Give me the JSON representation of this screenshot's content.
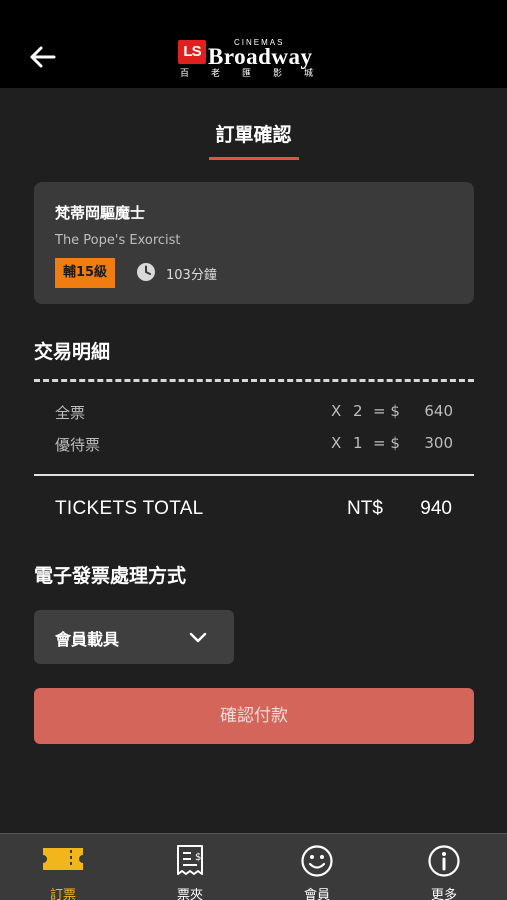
{
  "header": {
    "back_icon": "arrow-left-icon",
    "logo": {
      "badge": "LS",
      "cinemas": "CINEMAS",
      "brand": "Broadway",
      "sub": "百老匯影城"
    }
  },
  "page": {
    "title": "訂單確認"
  },
  "movie": {
    "name": "梵蒂岡驅魔士",
    "english_name": "The Pope's Exorcist",
    "rating": "輔15級",
    "duration": "103分鐘",
    "rating_color": "#ef7d10"
  },
  "transaction": {
    "title": "交易明細",
    "items": [
      {
        "name": "全票",
        "x": "X",
        "qty": "2",
        "eq": "= $",
        "amount": "640"
      },
      {
        "name": "優待票",
        "x": "X",
        "qty": "1",
        "eq": "= $",
        "amount": "300"
      }
    ],
    "total_label": "TICKETS TOTAL",
    "total_currency": "NT$",
    "total_amount": "940"
  },
  "invoice": {
    "title": "電子發票處理方式",
    "selected": "會員載具"
  },
  "confirm_button": {
    "label": "確認付款",
    "color": "#d4655b"
  },
  "tabbar": {
    "active_color": "#f2b51a",
    "tabs": [
      {
        "label": "訂票",
        "icon": "ticket-icon",
        "active": true
      },
      {
        "label": "票夾",
        "icon": "receipt-icon",
        "active": false
      },
      {
        "label": "會員",
        "icon": "smiley-icon",
        "active": false
      },
      {
        "label": "更多",
        "icon": "info-icon",
        "active": false
      }
    ]
  }
}
